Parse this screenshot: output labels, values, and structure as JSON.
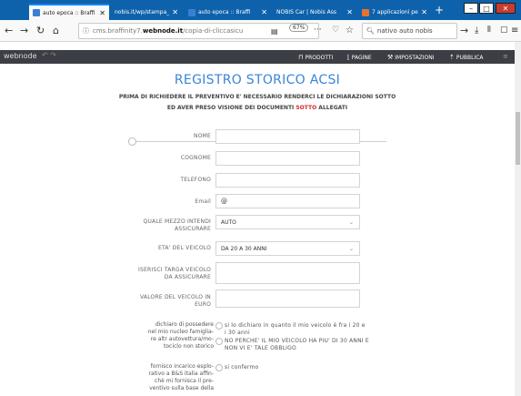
{
  "browser": {
    "tabs": [
      {
        "label": "auto epoca :: Braffi",
        "icon": "webnode-favicon",
        "active": true
      },
      {
        "label": "nobis.it/wp/stampa_t",
        "icon": "none",
        "active": false
      },
      {
        "label": "auto epoca :: Braffi",
        "icon": "webnode-favicon",
        "active": false
      },
      {
        "label": "NOBIS Car | Nobis Ass",
        "icon": "none",
        "active": false
      },
      {
        "label": "7 applicazioni per",
        "icon": "orange-favicon",
        "active": false
      }
    ],
    "tab_close": "✕",
    "new_tab": "+",
    "window_buttons": {
      "minimize": "–",
      "maximize": "□",
      "close": "✕"
    },
    "nav": {
      "back": "←",
      "forward": "→",
      "reload": "↻",
      "home": "⌂"
    },
    "url_prefix": "cms.braffinity7.",
    "url_domain": "webnode.it",
    "url_suffix": "/copia-di-cliccasicu",
    "zoom": "67%",
    "page_actions": "···",
    "search_text": "nativo auto nobis",
    "search_go": "→"
  },
  "webnode_toolbar": {
    "logo": "webnode",
    "undo": "↶  ↷",
    "items": [
      {
        "label": "PRODOTTI",
        "icon": "cart-icon"
      },
      {
        "label": "PAGINE",
        "icon": "pages-icon"
      },
      {
        "label": "IMPOSTAZIONI",
        "icon": "wrench-icon"
      },
      {
        "label": "PUBBLICA",
        "icon": "publish-icon"
      }
    ],
    "menu": "≡"
  },
  "page": {
    "title": "REGISTRO STORICO ACSI",
    "intro_line1": "PRIMA DI RICHIEDERE IL PREVENTIVO E' NECESSARIO RENDERCI LE DICHIARAZIONI SOTTO",
    "intro_line2_a": "ED AVER PRESO VISIONE DEI DOCUMENTI ",
    "intro_line2_red": "SOTTO",
    "intro_line2_b": " ALLEGATI",
    "fields": {
      "nome": "NOME",
      "cognome": "COGNOME",
      "telefono": "TELEFONO",
      "email": "Email",
      "email_value": "@",
      "mezzo_label_1": "QUALE MEZZO INTENDI",
      "mezzo_label_2": "ASSICURARE",
      "mezzo_value": "AUTO",
      "eta_label": "ETA' DEL VEICOLO",
      "eta_value": "DA 20 A 30 ANNI",
      "targa_label_1": "ISERISCI TARGA VEICOLO",
      "targa_label_2": "DA ASSICURARE",
      "valore_label_1": "VALORE DEL VEICOLO IN",
      "valore_label_2": "EURO"
    },
    "declaration1": {
      "label_lines": [
        "dichiaro di possedere",
        "nel mio nucleo famiglia-",
        "re altr autovettura/mo-",
        "tociclo non storico"
      ],
      "option1_lines": [
        "si lo dichiaro in quanto il mio veicolo è fra i 20 e",
        "i 30 anni"
      ],
      "option2_lines": [
        "NO PERCHE' IL MIO VEICOLO HA PIU' DI 30 ANNI E",
        "NON VI E' TALE OBBLIGO"
      ]
    },
    "declaration2": {
      "label_lines": [
        "fornisco incarico esplo-",
        "rativo a B&S italia affin-",
        "chè mi fornisca il pre-",
        "ventivo sulla base della"
      ],
      "option1_lines": [
        "si confermo"
      ]
    }
  }
}
